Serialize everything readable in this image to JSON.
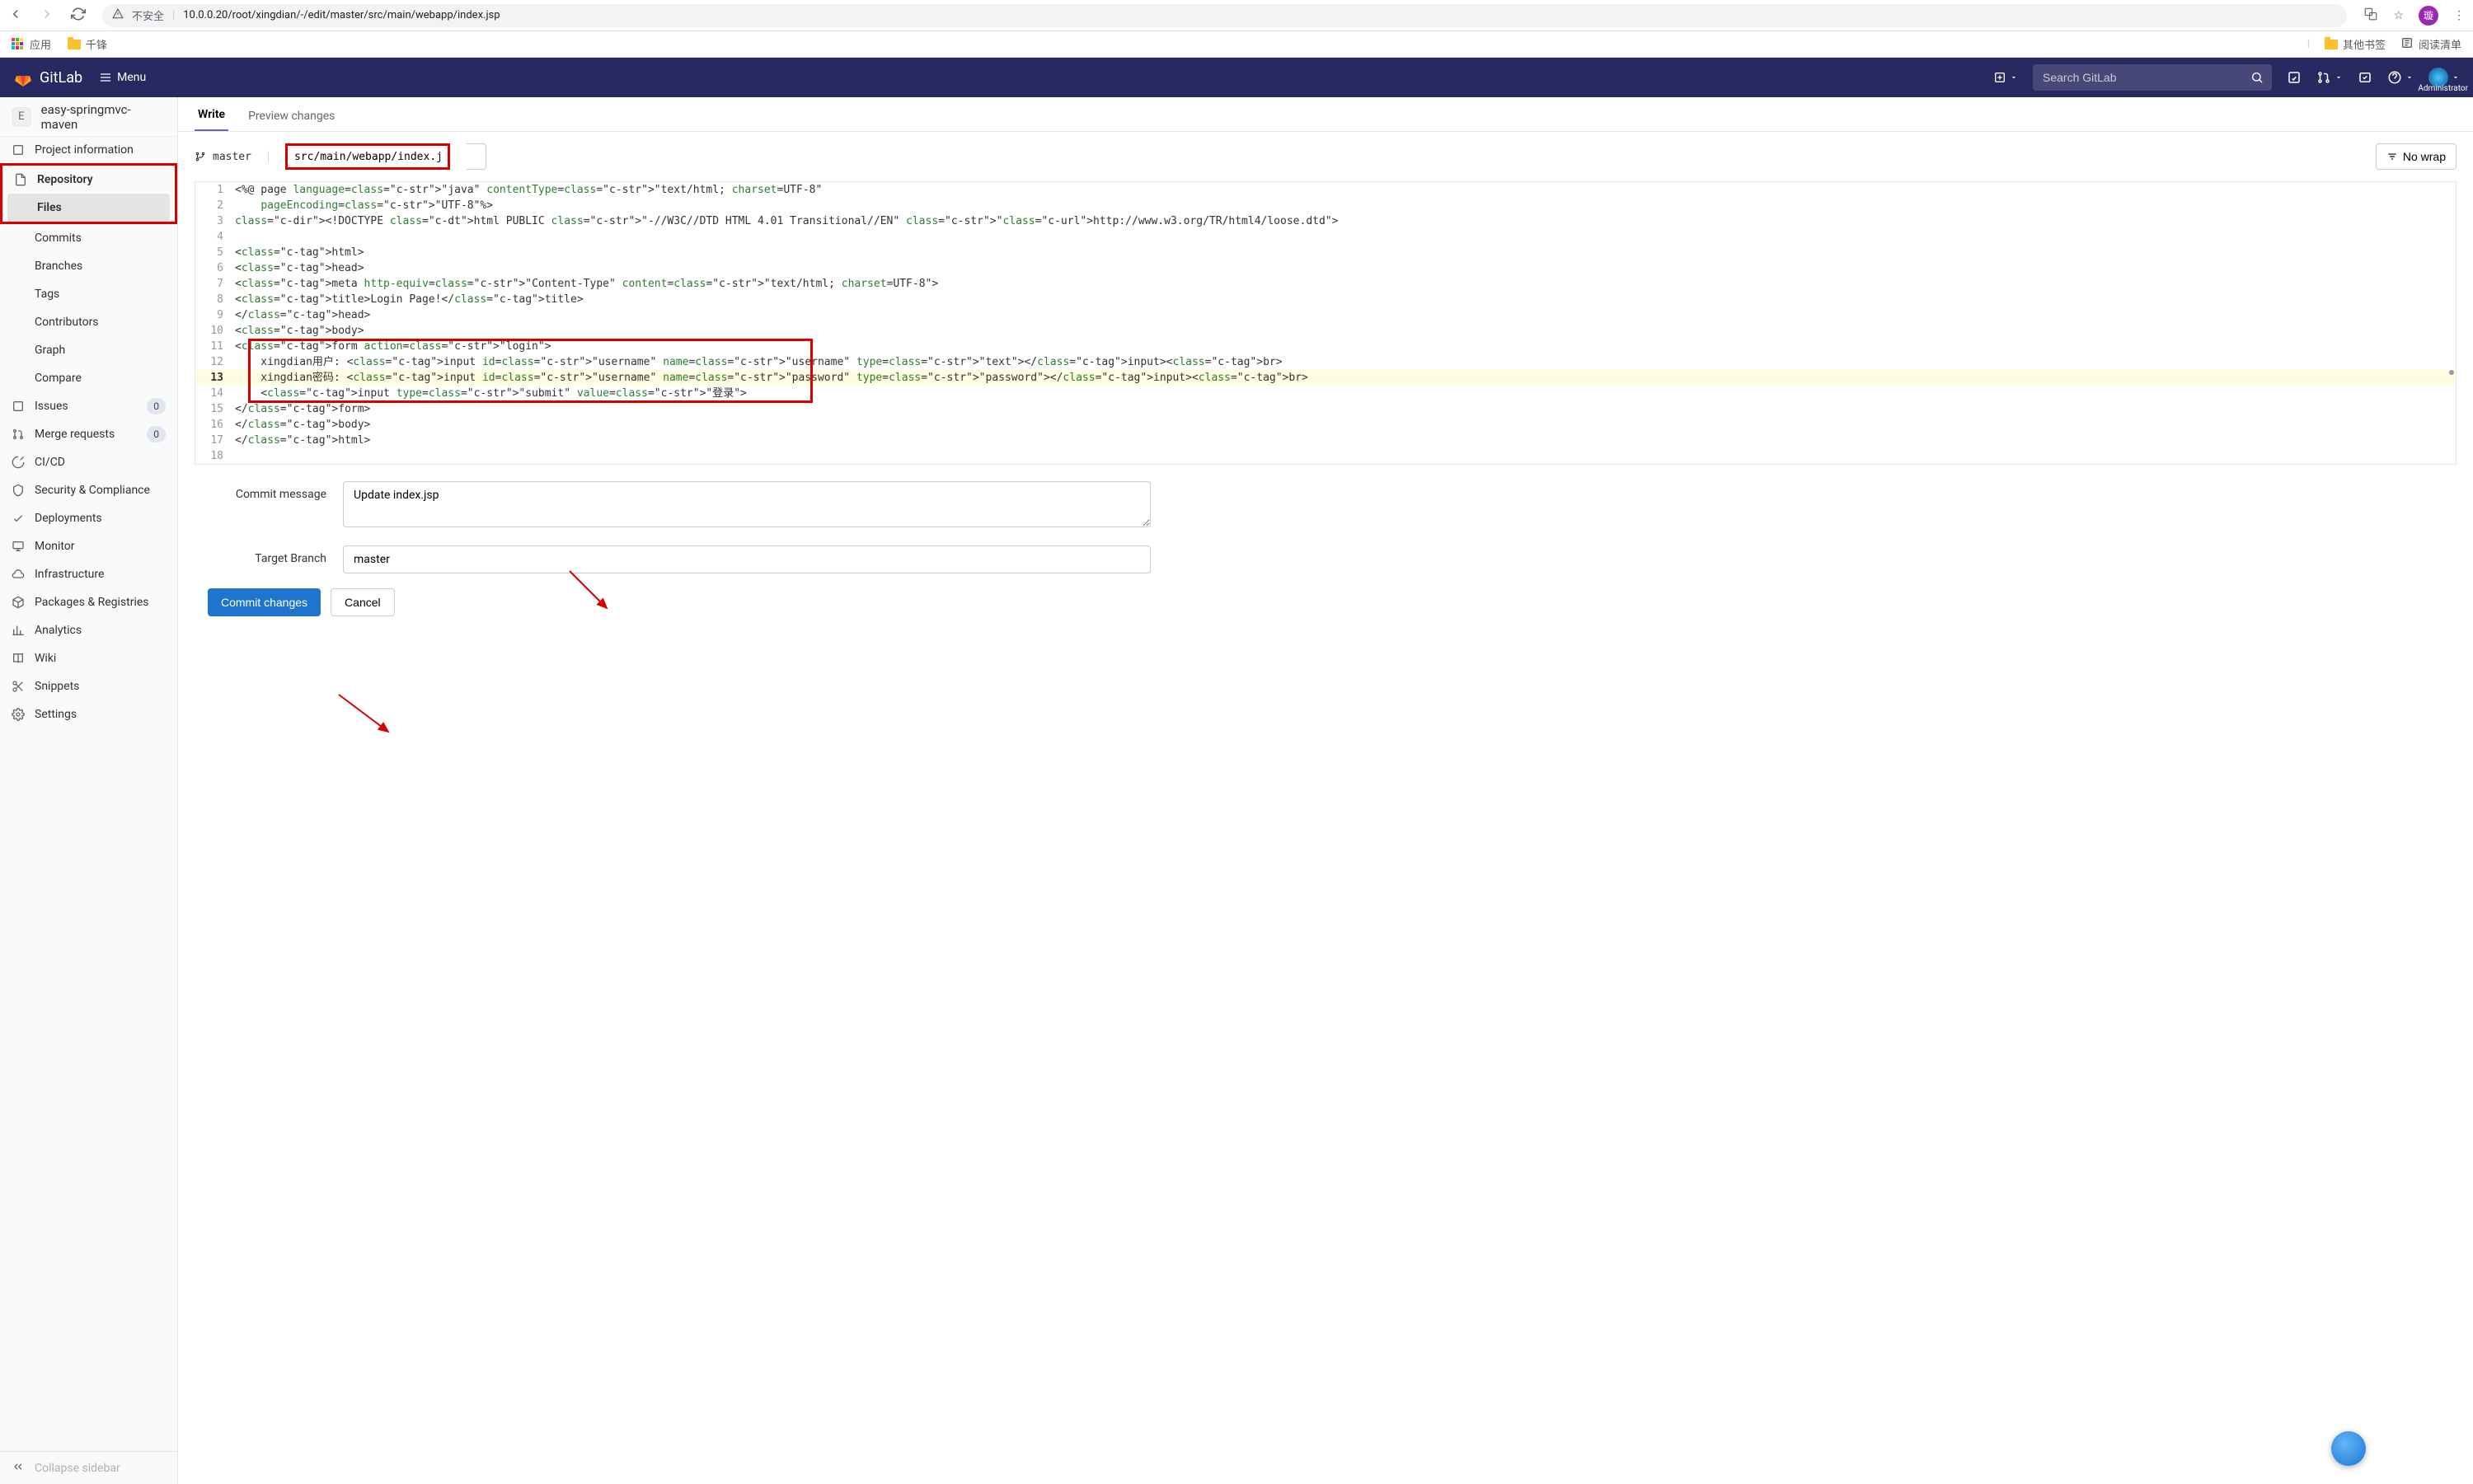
{
  "browser": {
    "security_label": "不安全",
    "url": "10.0.0.20/root/xingdian/-/edit/master/src/main/webapp/index.jsp",
    "avatar_letter": "璇",
    "bookmarks": {
      "apps": "应用",
      "qf": "千锋",
      "other": "其他书签",
      "reading": "阅读清单"
    }
  },
  "nav": {
    "brand": "GitLab",
    "menu": "Menu",
    "search_placeholder": "Search GitLab",
    "user_label": "Administrator"
  },
  "sidebar": {
    "project_letter": "E",
    "project_name": "easy-springmvc-maven",
    "items": {
      "project_info": "Project information",
      "repository": "Repository",
      "files": "Files",
      "commits": "Commits",
      "branches": "Branches",
      "tags": "Tags",
      "contributors": "Contributors",
      "graph": "Graph",
      "compare": "Compare",
      "issues": "Issues",
      "issues_count": "0",
      "merge": "Merge requests",
      "merge_count": "0",
      "cicd": "CI/CD",
      "security": "Security & Compliance",
      "deployments": "Deployments",
      "monitor": "Monitor",
      "infrastructure": "Infrastructure",
      "packages": "Packages & Registries",
      "analytics": "Analytics",
      "wiki": "Wiki",
      "snippets": "Snippets",
      "settings": "Settings",
      "collapse": "Collapse sidebar"
    }
  },
  "tabs": {
    "write": "Write",
    "preview": "Preview changes"
  },
  "editor": {
    "branch": "master",
    "filepath": "src/main/webapp/index.jsp",
    "nowrap": "No wrap",
    "lines": [
      "<%@ page language=\"java\" contentType=\"text/html; charset=UTF-8\"",
      "    pageEncoding=\"UTF-8\"%>",
      "<!DOCTYPE html PUBLIC \"-//W3C//DTD HTML 4.01 Transitional//EN\" \"http://www.w3.org/TR/html4/loose.dtd\">",
      "",
      "<html>",
      "<head>",
      "<meta http-equiv=\"Content-Type\" content=\"text/html; charset=UTF-8\">",
      "<title>Login Page!</title>",
      "</head>",
      "<body>",
      "<form action=\"login\">",
      "    xingdian用户: <input id=\"username\" name=\"username\" type=\"text\"></input><br>",
      "    xingdian密码: <input id=\"username\" name=\"password\" type=\"password\"></input><br>",
      "    <input type=\"submit\" value=\"登录\">",
      "</form>",
      "</body>",
      "</html>",
      ""
    ]
  },
  "form": {
    "commit_msg_label": "Commit message",
    "commit_msg_value": "Update index.jsp",
    "target_branch_label": "Target Branch",
    "target_branch_value": "master",
    "commit_btn": "Commit changes",
    "cancel_btn": "Cancel"
  }
}
